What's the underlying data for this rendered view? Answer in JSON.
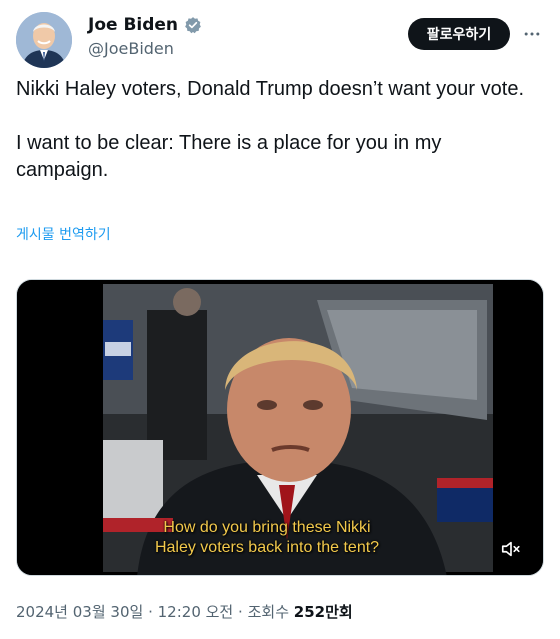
{
  "author": {
    "display_name": "Joe Biden",
    "handle": "@JoeBiden",
    "verified": true,
    "verified_color": "#829aab"
  },
  "follow_button": {
    "label": "팔로우하기"
  },
  "tweet": {
    "paragraphs": [
      "Nikki Haley voters, Donald Trump doesn’t want your vote.",
      "I want to be clear: There is a place for you in my campaign."
    ],
    "translate_label": "게시물 번역하기"
  },
  "media": {
    "caption_lines": [
      "How do you bring these Nikki",
      "Haley voters back into the tent?"
    ],
    "muted": true
  },
  "meta": {
    "date": "2024년 03월 30일",
    "time": "12:20 오전",
    "views_label": "조회수",
    "views_count": "252만회",
    "separator": "·"
  },
  "colors": {
    "accent_link": "#1d9bf0",
    "secondary_text": "#536471",
    "primary_text": "#0f1419"
  }
}
